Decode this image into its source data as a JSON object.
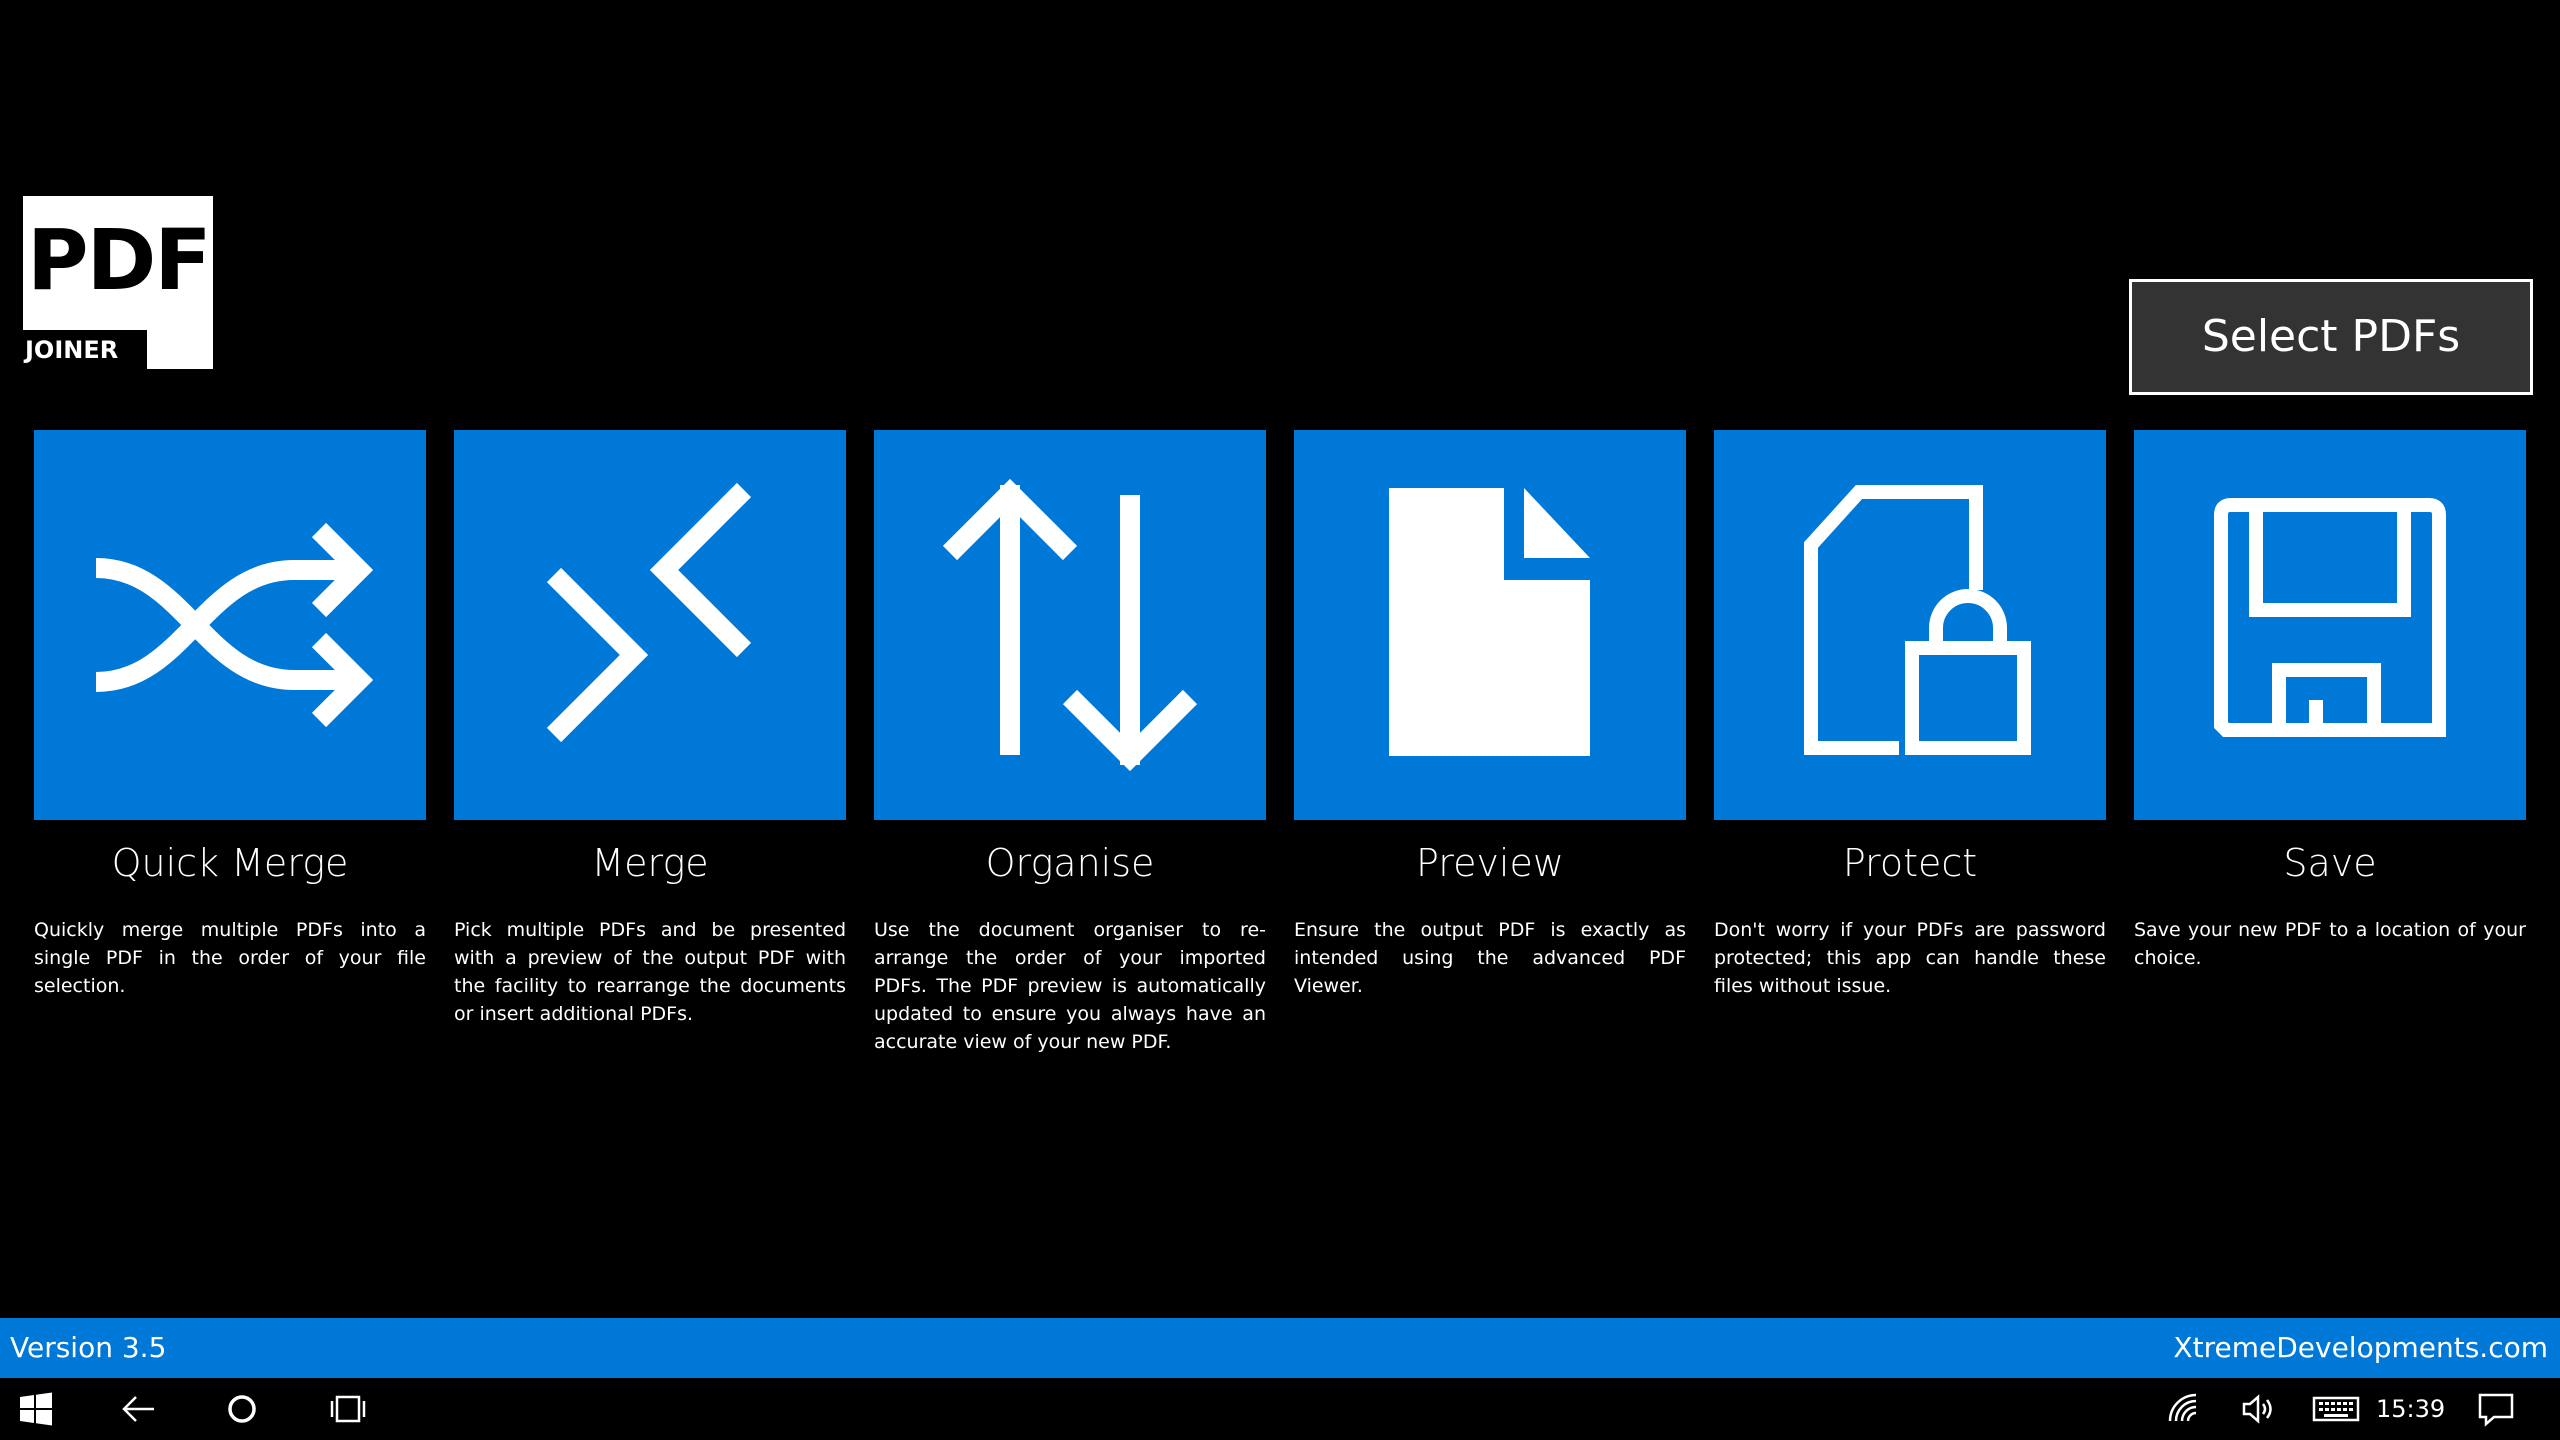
{
  "logo": {
    "main_text": "PDF",
    "sub_text": "JOINER"
  },
  "select_button": {
    "label": "Select PDFs"
  },
  "features": [
    {
      "icon": "shuffle-icon",
      "title": "Quick Merge",
      "description": "Quickly merge multiple PDFs into a single PDF in the order of your file selection."
    },
    {
      "icon": "merge-icon",
      "title": "Merge",
      "description": "Pick multiple PDFs and be presented with a preview of the output PDF with the facility to rearrange the documents or insert additional PDFs."
    },
    {
      "icon": "sort-arrows-icon",
      "title": "Organise",
      "description": "Use the document organiser to re-arrange the order of your imported PDFs. The PDF preview is automatically updated to ensure you always have an accurate view of your new PDF."
    },
    {
      "icon": "document-icon",
      "title": "Preview",
      "description": "Ensure the output PDF is exactly as intended using the advanced PDF Viewer."
    },
    {
      "icon": "protected-document-icon",
      "title": "Protect",
      "description": "Don't worry if your PDFs are password protected; this app can handle these files without issue."
    },
    {
      "icon": "floppy-disk-icon",
      "title": "Save",
      "description": "Save your new PDF to a location of your choice."
    }
  ],
  "status_bar": {
    "version": "Version 3.5",
    "website": "XtremeDevelopments.com"
  },
  "taskbar": {
    "clock": "15:39",
    "icons": [
      "windows-start-icon",
      "back-arrow-icon",
      "cortana-icon",
      "task-view-icon",
      "wifi-icon",
      "volume-icon",
      "keyboard-icon",
      "action-center-icon"
    ]
  },
  "colors": {
    "accent": "#0078d7",
    "background": "#000000",
    "button_bg": "#333333"
  }
}
